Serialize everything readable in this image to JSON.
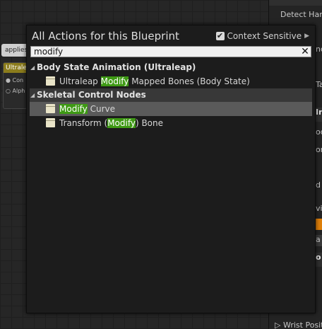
{
  "background": {
    "node_tag": "applies",
    "node_title": "Ultrale",
    "pin1": "Con",
    "pin2": "Alph"
  },
  "details": {
    "rows": [
      "Detect Hand",
      "nd",
      "Ta",
      "",
      "In",
      "ody",
      "on",
      "",
      "d D",
      "",
      "vie",
      "",
      "a",
      "",
      "o A"
    ],
    "bottom": "Wrist Positi"
  },
  "menu": {
    "title": "All Actions for this Blueprint",
    "context_label": "Context Sensitive",
    "search_value": "modify",
    "categories": [
      {
        "label": "Body State Animation (Ultraleap)",
        "items": [
          {
            "pre": "Ultraleap ",
            "match": "Modify",
            "post": " Mapped Bones (Body State)"
          }
        ]
      },
      {
        "label": "Skeletal Control Nodes",
        "items": [
          {
            "pre": "",
            "match": "Modify",
            "post": " Curve"
          },
          {
            "pre": "Transform (",
            "match": "Modify",
            "post": ") Bone"
          }
        ]
      }
    ]
  },
  "colors": {
    "highlight": "#3e9a14",
    "selection": "#5a5a5a",
    "node_header": "#8b7c1c"
  }
}
